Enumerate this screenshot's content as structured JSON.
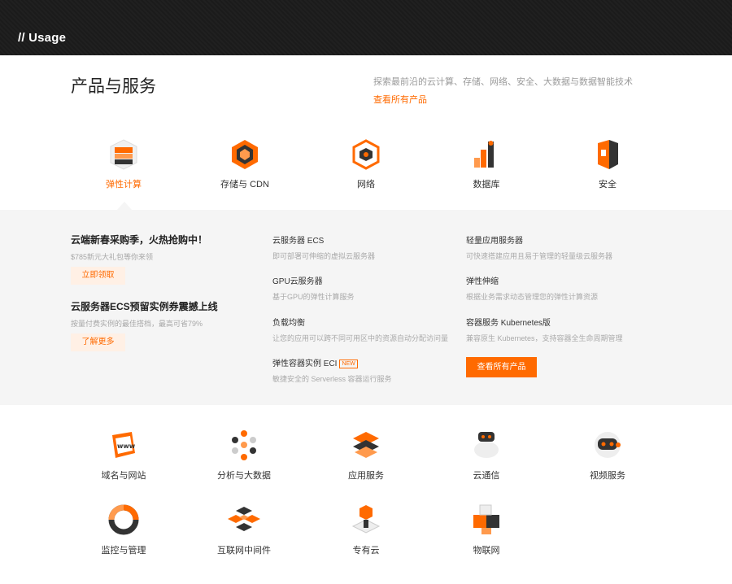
{
  "topbar": {
    "label": "// Usage"
  },
  "header": {
    "title": "产品与服务",
    "description": "探索最前沿的云计算、存储、网络、安全、大数据与数据智能技术",
    "link": "查看所有产品"
  },
  "categories": [
    {
      "label": "弹性计算",
      "icon": "elastic-compute-icon",
      "active": true
    },
    {
      "label": "存储与 CDN",
      "icon": "storage-cdn-icon"
    },
    {
      "label": "网络",
      "icon": "network-icon"
    },
    {
      "label": "数据库",
      "icon": "database-icon"
    },
    {
      "label": "安全",
      "icon": "security-icon"
    }
  ],
  "promos": [
    {
      "title": "云端新春采购季，火热抢购中！",
      "subtitle": "$785新元大礼包等你来领",
      "button": "立即领取"
    },
    {
      "title": "云服务器ECS预留实例券震撼上线",
      "subtitle": "按量付费实例的最佳搭档，最高可省79%",
      "button": "了解更多"
    }
  ],
  "products": [
    {
      "title": "云服务器 ECS",
      "desc": "即可部署可伸缩的虚拟云服务器"
    },
    {
      "title": "GPU云服务器",
      "desc": "基于GPU的弹性计算服务"
    },
    {
      "title": "负载均衡",
      "desc": "让您的应用可以跨不同可用区中的资源自动分配访问量"
    },
    {
      "title": "弹性容器实例 ECI",
      "badge": "NEW",
      "desc": "敏捷安全的 Serverless 容器运行服务"
    },
    {
      "title": "轻量应用服务器",
      "desc": "可快速搭建应用且易于管理的轻量级云服务器"
    },
    {
      "title": "弹性伸缩",
      "desc": "根据业务需求动态管理您的弹性计算资源"
    },
    {
      "title": "容器服务 Kubernetes版",
      "desc": "兼容原生 Kubernetes，支持容器全生命周期管理"
    }
  ],
  "all_products_button": "查看所有产品",
  "services": [
    {
      "label": "域名与网站",
      "icon": "www-domain-icon"
    },
    {
      "label": "分析与大数据",
      "icon": "analytics-bigdata-icon"
    },
    {
      "label": "应用服务",
      "icon": "app-service-icon"
    },
    {
      "label": "云通信",
      "icon": "cloud-communication-icon"
    },
    {
      "label": "视频服务",
      "icon": "video-service-icon"
    },
    {
      "label": "监控与管理",
      "icon": "monitoring-icon"
    },
    {
      "label": "互联网中间件",
      "icon": "middleware-icon"
    },
    {
      "label": "专有云",
      "icon": "private-cloud-icon"
    },
    {
      "label": "物联网",
      "icon": "iot-icon"
    }
  ],
  "colors": {
    "accent": "#ff6a00",
    "dark": "#1b1b1b",
    "panel": "#f5f5f5"
  }
}
